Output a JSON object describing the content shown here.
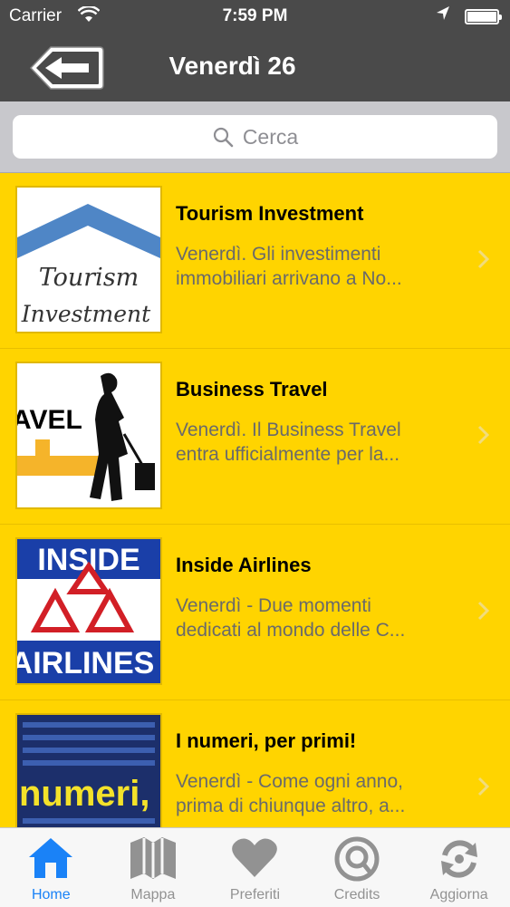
{
  "status": {
    "carrier": "Carrier",
    "time": "7:59 PM"
  },
  "nav": {
    "title": "Venerdì 26"
  },
  "search": {
    "placeholder": "Cerca"
  },
  "items": [
    {
      "title": "Tourism Investment",
      "line1": "Venerdì. Gli investimenti",
      "line2": "immobiliari arrivano a No...",
      "thumb_text_1": "Tourism",
      "thumb_text_2": "Investment"
    },
    {
      "title": "Business Travel",
      "line1": "Venerdì. Il Business Travel",
      "line2": "entra ufficialmente per la...",
      "thumb_text_1": "AVEL"
    },
    {
      "title": "Inside Airlines",
      "line1": "Venerdì - Due momenti",
      "line2": "dedicati al mondo delle C...",
      "thumb_text_1": "INSIDE",
      "thumb_text_2": "AIRLINES"
    },
    {
      "title": "I numeri, per primi!",
      "line1": "Venerdì - Come ogni anno,",
      "line2": "prima di chiunque altro, a...",
      "thumb_text_1": "numeri,"
    }
  ],
  "tabs": [
    {
      "label": "Home",
      "icon": "home-icon",
      "active": true
    },
    {
      "label": "Mappa",
      "icon": "map-icon"
    },
    {
      "label": "Preferiti",
      "icon": "heart-icon"
    },
    {
      "label": "Credits",
      "icon": "credits-icon"
    },
    {
      "label": "Aggiorna",
      "icon": "refresh-icon"
    }
  ],
  "colors": {
    "accent": "#1a82f7",
    "background": "#FFD400",
    "bar": "#4a4a4a"
  }
}
